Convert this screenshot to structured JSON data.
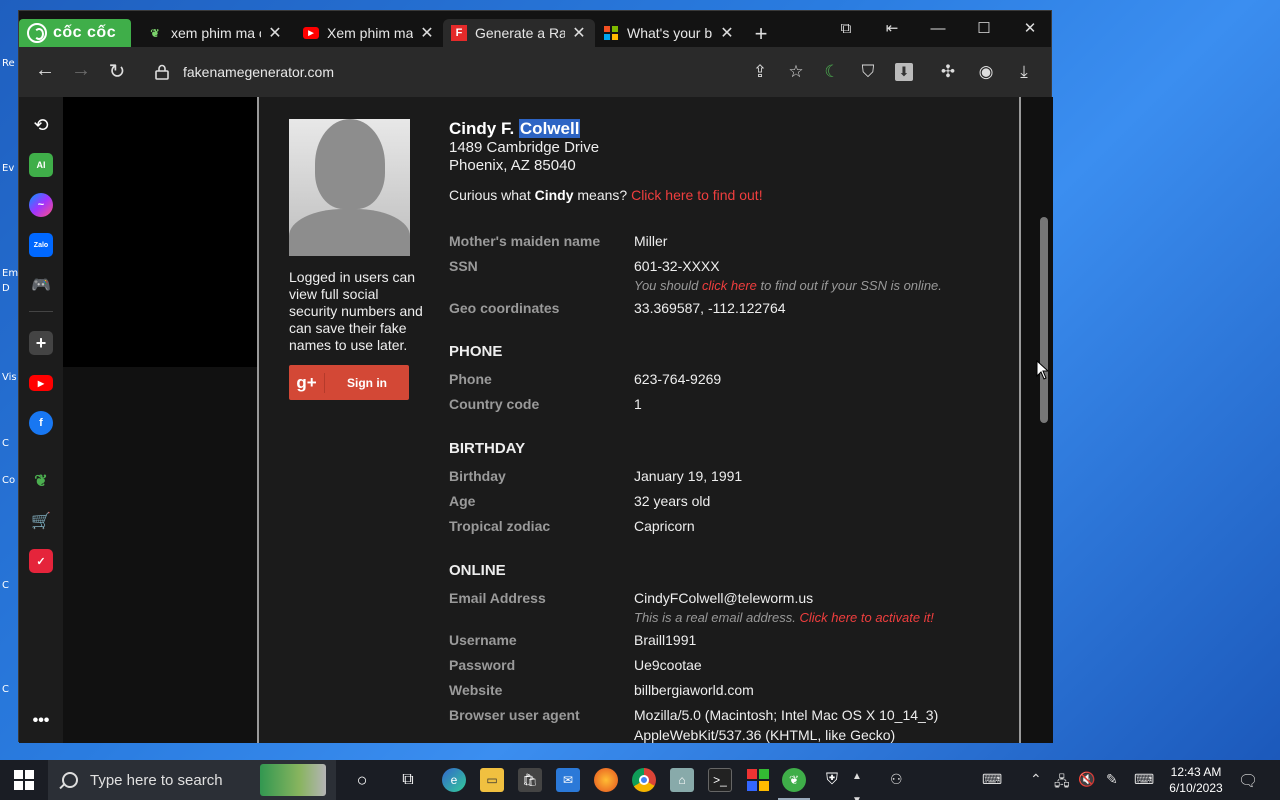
{
  "desktop": {
    "edge_labels": [
      "Re",
      "Ev",
      "Em",
      "D",
      "Vis",
      "C",
      "Co",
      "C",
      "C"
    ]
  },
  "browser": {
    "brand": "cốc cốc",
    "tabs": [
      {
        "title": "xem phim ma c",
        "favicon": "coccoc-leaf-icon",
        "active": false
      },
      {
        "title": "Xem phim ma",
        "favicon": "youtube-icon",
        "active": false
      },
      {
        "title": "Generate a Rar",
        "favicon": "fakename-f-icon",
        "active": true
      },
      {
        "title": "What's your bi",
        "favicon": "microsoft-icon",
        "active": false
      }
    ],
    "new_tab": "+",
    "url": "fakenamegenerator.com"
  },
  "person": {
    "first_middle": "Cindy F.",
    "last": "Colwell",
    "address_line1": "1489 Cambridge Drive",
    "address_line2": "Phoenix, AZ 85040",
    "curious_prefix": "Curious what",
    "curious_name": "Cindy",
    "curious_suffix": "means?",
    "curious_link": "Click here to find out!",
    "login_note": "Logged in users can view full social security numbers and can save their fake names to use later.",
    "signin_label": "Sign in",
    "signin_g": "g+"
  },
  "fields": {
    "maiden_label": "Mother's maiden name",
    "maiden": "Miller",
    "ssn_label": "SSN",
    "ssn": "601-32-XXXX",
    "ssn_note_pre": "You should",
    "ssn_note_link": "click here",
    "ssn_note_post": "to find out if your SSN is online.",
    "geo_label": "Geo coordinates",
    "geo": "33.369587, -112.122764",
    "phone_section": "PHONE",
    "phone_label": "Phone",
    "phone": "623-764-9269",
    "cc_label": "Country code",
    "cc": "1",
    "birthday_section": "BIRTHDAY",
    "bday_label": "Birthday",
    "bday": "January 19, 1991",
    "age_label": "Age",
    "age": "32 years old",
    "zodiac_label": "Tropical zodiac",
    "zodiac": "Capricorn",
    "online_section": "ONLINE",
    "email_label": "Email Address",
    "email": "CindyFColwell@teleworm.us",
    "email_note_pre": "This is a real email address.",
    "email_note_link": "Click here to activate it!",
    "user_label": "Username",
    "user": "Braill1991",
    "pass_label": "Password",
    "pass": "Ue9cootae",
    "web_label": "Website",
    "web": "billbergiaworld.com",
    "ua_label": "Browser user agent",
    "ua1": "Mozilla/5.0 (Macintosh; Intel Mac OS X 10_14_3)",
    "ua2": "AppleWebKit/537.36 (KHTML, like Gecko)"
  },
  "taskbar": {
    "search_placeholder": "Type here to search",
    "time": "12:43 AM",
    "date": "6/10/2023"
  },
  "colors": {
    "accent_red": "#ef3e3e",
    "coccoc_green": "#3fae49",
    "google_red": "#d34836",
    "selection_blue": "#2d64c4"
  }
}
